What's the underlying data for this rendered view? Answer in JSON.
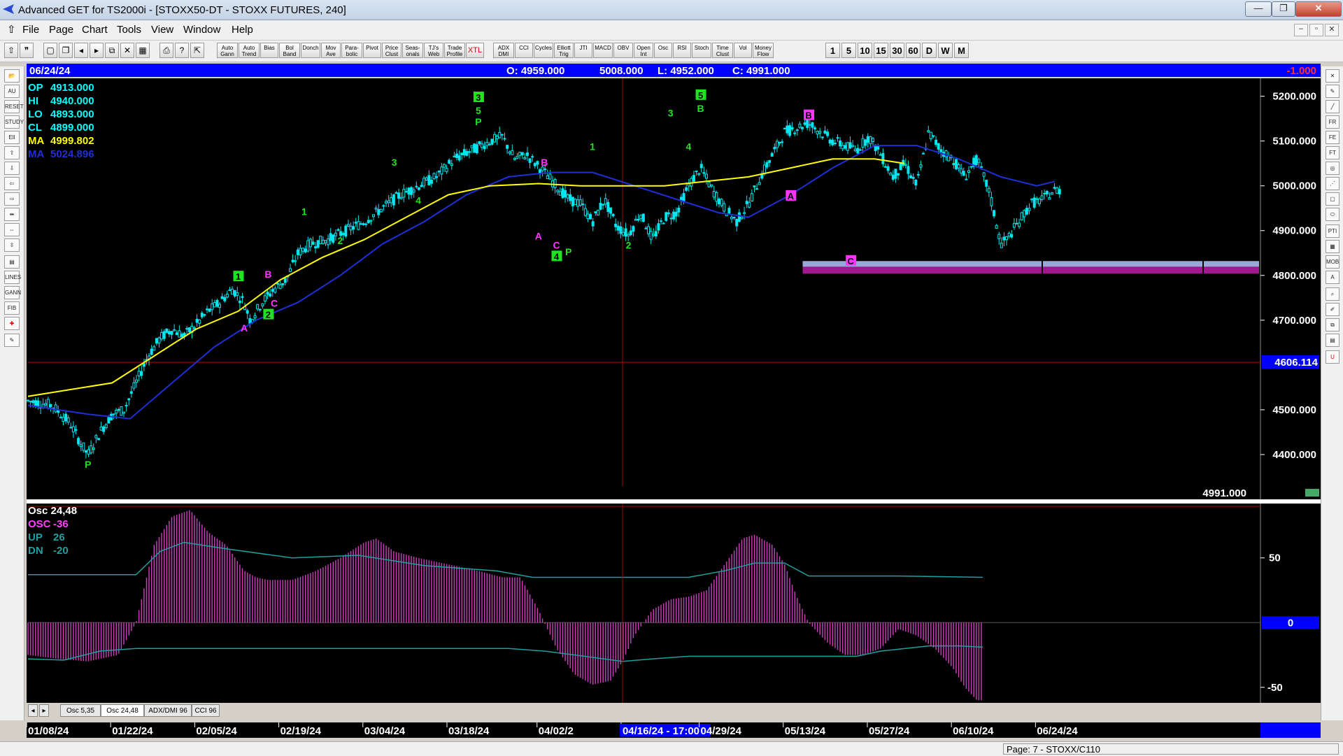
{
  "window": {
    "title": "Advanced GET for TS2000i - [STOXX50-DT - STOXX FUTURES, 240]"
  },
  "menu": [
    "File",
    "Page",
    "Chart",
    "Tools",
    "View",
    "Window",
    "Help"
  ],
  "toolbar": {
    "study_buttons": [
      "Auto Gann",
      "Auto Trend",
      "Bias",
      "Bol Band",
      "Donch",
      "Mov Ave",
      "Para-bolic",
      "Pivot",
      "Price Clust",
      "Seas-onals",
      "TJ's Web",
      "Trade Profile",
      "XTL",
      "ADX DMI",
      "CCI",
      "Cycles",
      "Elliott Trig",
      "JTI",
      "MACD",
      "OBV",
      "Open Int",
      "Osc",
      "RSI",
      "Stoch",
      "Time Clust",
      "Vol",
      "Money Flow"
    ],
    "periods": [
      "1",
      "5",
      "10",
      "15",
      "30",
      "60",
      "D",
      "W",
      "M"
    ]
  },
  "header": {
    "date": "06/24/24",
    "open": "O: 4959.000",
    "high": "5008.000",
    "low": "L: 4952.000",
    "close": "C: 4991.000",
    "change": "-1.000"
  },
  "price_legend": [
    {
      "label": "OP",
      "value": "4913.000",
      "color": "#00ffff"
    },
    {
      "label": "HI",
      "value": "4940.000",
      "color": "#00ffff"
    },
    {
      "label": "LO",
      "value": "4893.000",
      "color": "#00ffff"
    },
    {
      "label": "CL",
      "value": "4899.000",
      "color": "#00ffff"
    },
    {
      "label": "MA",
      "value": "4999.802",
      "color": "#ffff00"
    },
    {
      "label": "MA",
      "value": "5024.896",
      "color": "#1f2fd6"
    }
  ],
  "osc_legend": [
    {
      "label": "Osc 24,48",
      "value": "",
      "color": "#ffffff"
    },
    {
      "label": "OSC",
      "value": "-36",
      "color": "#ff40ff"
    },
    {
      "label": "UP",
      "value": "26",
      "color": "#1fa0a0"
    },
    {
      "label": "DN",
      "value": "-20",
      "color": "#1fa0a0"
    }
  ],
  "tabs": [
    "Osc 5,35",
    "Osc 24,48",
    "ADX/DMI 96",
    "CCI 96"
  ],
  "status": {
    "page": "Page: 7 - STOXX/C110"
  },
  "colors": {
    "background": "#000000",
    "header_bar": "#0000ff",
    "candle": "#00ffff",
    "ma_fast": "#ffff00",
    "ma_slow": "#1f2fd6",
    "osc_bar": "#d040c0",
    "wave_green": "#22e022",
    "wave_magenta": "#ff33ff"
  },
  "chart_data": [
    {
      "type": "candlestick",
      "title": "STOXX50-DT - STOXX FUTURES, 240",
      "ylim": [
        4300,
        5240
      ],
      "y_ticks": [
        "5200.000",
        "5100.000",
        "5000.000",
        "4900.000",
        "4800.000",
        "4700.000",
        "4600.000",
        "4500.000",
        "4400.000"
      ],
      "x_ticks": [
        "01/08/24",
        "01/22/24",
        "02/05/24",
        "02/19/24",
        "03/04/24",
        "03/18/24",
        "04/02/2",
        "04/16/24 - 17:00",
        "04/29/24",
        "05/13/24",
        "05/27/24",
        "06/10/24",
        "06/24/24"
      ],
      "x_tick_days": [
        0,
        14,
        28,
        42,
        56,
        70,
        85,
        99,
        112,
        126,
        140,
        154,
        168
      ],
      "x_range_days": [
        0,
        205
      ],
      "last_day": 164,
      "trend_path": [
        [
          0,
          4520
        ],
        [
          4,
          4510
        ],
        [
          7,
          4470
        ],
        [
          9,
          4420
        ],
        [
          10,
          4400
        ],
        [
          12,
          4450
        ],
        [
          14,
          4490
        ],
        [
          16,
          4500
        ],
        [
          18,
          4560
        ],
        [
          20,
          4620
        ],
        [
          22,
          4660
        ],
        [
          24,
          4680
        ],
        [
          26,
          4665
        ],
        [
          28,
          4690
        ],
        [
          30,
          4720
        ],
        [
          32,
          4740
        ],
        [
          34,
          4770
        ],
        [
          36,
          4740
        ],
        [
          37,
          4700
        ],
        [
          39,
          4740
        ],
        [
          41,
          4770
        ],
        [
          43,
          4790
        ],
        [
          45,
          4850
        ],
        [
          47,
          4870
        ],
        [
          50,
          4880
        ],
        [
          53,
          4900
        ],
        [
          56,
          4920
        ],
        [
          59,
          4950
        ],
        [
          62,
          4980
        ],
        [
          65,
          5000
        ],
        [
          68,
          5020
        ],
        [
          71,
          5060
        ],
        [
          74,
          5080
        ],
        [
          77,
          5100
        ],
        [
          79,
          5110
        ],
        [
          81,
          5060
        ],
        [
          83,
          5070
        ],
        [
          86,
          5030
        ],
        [
          88,
          5000
        ],
        [
          90,
          4970
        ],
        [
          92,
          4960
        ],
        [
          94,
          4920
        ],
        [
          96,
          4970
        ],
        [
          98,
          4910
        ],
        [
          100,
          4890
        ],
        [
          102,
          4940
        ],
        [
          104,
          4880
        ],
        [
          106,
          4930
        ],
        [
          108,
          4940
        ],
        [
          110,
          5000
        ],
        [
          112,
          5040
        ],
        [
          114,
          4990
        ],
        [
          116,
          4950
        ],
        [
          118,
          4920
        ],
        [
          120,
          4960
        ],
        [
          122,
          5020
        ],
        [
          124,
          5070
        ],
        [
          126,
          5120
        ],
        [
          128,
          5130
        ],
        [
          130,
          5140
        ],
        [
          132,
          5120
        ],
        [
          134,
          5100
        ],
        [
          136,
          5090
        ],
        [
          138,
          5080
        ],
        [
          140,
          5110
        ],
        [
          142,
          5070
        ],
        [
          144,
          5020
        ],
        [
          146,
          5050
        ],
        [
          148,
          5000
        ],
        [
          150,
          5120
        ],
        [
          152,
          5080
        ],
        [
          154,
          5060
        ],
        [
          156,
          5020
        ],
        [
          158,
          5060
        ],
        [
          160,
          4990
        ],
        [
          162,
          4870
        ],
        [
          163,
          4880
        ],
        [
          165,
          4920
        ],
        [
          167,
          4960
        ],
        [
          169,
          4970
        ],
        [
          171,
          4990
        ],
        [
          172,
          4991
        ]
      ],
      "ma_fast": [
        [
          0,
          4530
        ],
        [
          14,
          4560
        ],
        [
          21,
          4620
        ],
        [
          28,
          4680
        ],
        [
          35,
          4720
        ],
        [
          42,
          4790
        ],
        [
          49,
          4840
        ],
        [
          56,
          4880
        ],
        [
          63,
          4930
        ],
        [
          70,
          4980
        ],
        [
          77,
          5000
        ],
        [
          85,
          5005
        ],
        [
          92,
          5000
        ],
        [
          99,
          5000
        ],
        [
          106,
          5000
        ],
        [
          113,
          5010
        ],
        [
          120,
          5020
        ],
        [
          127,
          5040
        ],
        [
          134,
          5060
        ],
        [
          141,
          5060
        ],
        [
          146,
          5050
        ]
      ],
      "ma_slow": [
        [
          0,
          4510
        ],
        [
          10,
          4490
        ],
        [
          17,
          4480
        ],
        [
          24,
          4560
        ],
        [
          31,
          4640
        ],
        [
          38,
          4700
        ],
        [
          45,
          4740
        ],
        [
          52,
          4800
        ],
        [
          59,
          4870
        ],
        [
          66,
          4920
        ],
        [
          73,
          4980
        ],
        [
          80,
          5020
        ],
        [
          87,
          5030
        ],
        [
          94,
          5030
        ],
        [
          101,
          5000
        ],
        [
          108,
          4970
        ],
        [
          115,
          4940
        ],
        [
          120,
          4930
        ],
        [
          127,
          4980
        ],
        [
          134,
          5040
        ],
        [
          141,
          5090
        ],
        [
          148,
          5090
        ],
        [
          155,
          5060
        ],
        [
          162,
          5020
        ],
        [
          168,
          5000
        ],
        [
          171,
          5010
        ]
      ],
      "support_band": {
        "from_day": 129,
        "to_day": 205,
        "upper": 4832,
        "lower": 4810
      },
      "horizontal_line": {
        "value": 4606.114,
        "label": "4606.114"
      },
      "crosshair_day": 99,
      "last_price_label": "4991.000",
      "wave_labels": [
        {
          "day": 10,
          "price": 4370,
          "text": "P",
          "color": "green",
          "boxed": false
        },
        {
          "day": 36,
          "price": 4675,
          "text": "A",
          "color": "magenta",
          "boxed": false
        },
        {
          "day": 35,
          "price": 4790,
          "text": "1",
          "color": "green",
          "boxed": true
        },
        {
          "day": 40,
          "price": 4795,
          "text": "B",
          "color": "magenta",
          "boxed": false
        },
        {
          "day": 41,
          "price": 4730,
          "text": "C",
          "color": "magenta",
          "boxed": false
        },
        {
          "day": 40,
          "price": 4705,
          "text": "2",
          "color": "green",
          "boxed": true
        },
        {
          "day": 46,
          "price": 4935,
          "text": "1",
          "color": "green",
          "boxed": false
        },
        {
          "day": 52,
          "price": 4870,
          "text": "2",
          "color": "green",
          "boxed": false
        },
        {
          "day": 61,
          "price": 5045,
          "text": "3",
          "color": "green",
          "boxed": false
        },
        {
          "day": 65,
          "price": 4960,
          "text": "4",
          "color": "green",
          "boxed": false
        },
        {
          "day": 75,
          "price": 5190,
          "text": "3",
          "color": "green",
          "boxed": true
        },
        {
          "day": 75,
          "price": 5160,
          "text": "5",
          "color": "green",
          "boxed": false
        },
        {
          "day": 75,
          "price": 5135,
          "text": "P",
          "color": "green",
          "boxed": false
        },
        {
          "day": 86,
          "price": 5045,
          "text": "B",
          "color": "magenta",
          "boxed": false
        },
        {
          "day": 85,
          "price": 4880,
          "text": "A",
          "color": "magenta",
          "boxed": false
        },
        {
          "day": 88,
          "price": 4860,
          "text": "C",
          "color": "magenta",
          "boxed": false
        },
        {
          "day": 88,
          "price": 4835,
          "text": "4",
          "color": "green",
          "boxed": true
        },
        {
          "day": 90,
          "price": 4845,
          "text": "P",
          "color": "green",
          "boxed": false
        },
        {
          "day": 94,
          "price": 5080,
          "text": "1",
          "color": "green",
          "boxed": false
        },
        {
          "day": 100,
          "price": 4860,
          "text": "2",
          "color": "green",
          "boxed": false
        },
        {
          "day": 107,
          "price": 5155,
          "text": "3",
          "color": "green",
          "boxed": false
        },
        {
          "day": 110,
          "price": 5080,
          "text": "4",
          "color": "green",
          "boxed": false
        },
        {
          "day": 112,
          "price": 5195,
          "text": "5",
          "color": "green",
          "boxed": true
        },
        {
          "day": 112,
          "price": 5165,
          "text": "B",
          "color": "green",
          "boxed": false
        },
        {
          "day": 130,
          "price": 5150,
          "text": "B",
          "color": "magenta",
          "boxed": true
        },
        {
          "day": 127,
          "price": 4970,
          "text": "A",
          "color": "magenta",
          "boxed": true
        },
        {
          "day": 137,
          "price": 4825,
          "text": "C",
          "color": "magenta",
          "boxed": true
        }
      ]
    },
    {
      "type": "bar",
      "title": "Osc 24,48",
      "ylim": [
        -62,
        92
      ],
      "y_ticks": [
        "50",
        "0",
        "-50"
      ],
      "osc_path": [
        [
          0,
          -25
        ],
        [
          5,
          -28
        ],
        [
          10,
          -30
        ],
        [
          15,
          -25
        ],
        [
          18,
          0
        ],
        [
          21,
          60
        ],
        [
          24,
          82
        ],
        [
          27,
          87
        ],
        [
          30,
          70
        ],
        [
          33,
          60
        ],
        [
          36,
          40
        ],
        [
          38,
          35
        ],
        [
          40,
          33
        ],
        [
          44,
          33
        ],
        [
          48,
          40
        ],
        [
          52,
          50
        ],
        [
          56,
          62
        ],
        [
          58,
          65
        ],
        [
          61,
          55
        ],
        [
          65,
          50
        ],
        [
          70,
          45
        ],
        [
          75,
          40
        ],
        [
          79,
          35
        ],
        [
          82,
          35
        ],
        [
          85,
          10
        ],
        [
          88,
          -20
        ],
        [
          91,
          -40
        ],
        [
          94,
          -48
        ],
        [
          97,
          -45
        ],
        [
          99,
          -30
        ],
        [
          101,
          -10
        ],
        [
          104,
          10
        ],
        [
          107,
          18
        ],
        [
          110,
          20
        ],
        [
          113,
          25
        ],
        [
          116,
          45
        ],
        [
          119,
          65
        ],
        [
          121,
          68
        ],
        [
          124,
          60
        ],
        [
          126,
          45
        ],
        [
          128,
          20
        ],
        [
          130,
          0
        ],
        [
          133,
          -15
        ],
        [
          136,
          -25
        ],
        [
          139,
          -25
        ],
        [
          142,
          -20
        ],
        [
          145,
          -5
        ],
        [
          148,
          -10
        ],
        [
          151,
          -20
        ],
        [
          154,
          -35
        ],
        [
          156,
          -50
        ],
        [
          158,
          -60
        ],
        [
          159,
          -60
        ]
      ],
      "up_line": [
        [
          0,
          37
        ],
        [
          14,
          37
        ],
        [
          18,
          37
        ],
        [
          22,
          55
        ],
        [
          26,
          62
        ],
        [
          33,
          57
        ],
        [
          44,
          50
        ],
        [
          55,
          52
        ],
        [
          66,
          44
        ],
        [
          78,
          40
        ],
        [
          84,
          35
        ],
        [
          99,
          35
        ],
        [
          110,
          35
        ],
        [
          116,
          40
        ],
        [
          121,
          46
        ],
        [
          126,
          46
        ],
        [
          130,
          36
        ],
        [
          145,
          36
        ],
        [
          159,
          35
        ]
      ],
      "dn_line": [
        [
          0,
          -28
        ],
        [
          6,
          -29
        ],
        [
          12,
          -22
        ],
        [
          18,
          -20
        ],
        [
          30,
          -20
        ],
        [
          60,
          -20
        ],
        [
          80,
          -20
        ],
        [
          86,
          -22
        ],
        [
          91,
          -25
        ],
        [
          99,
          -30
        ],
        [
          104,
          -28
        ],
        [
          110,
          -26
        ],
        [
          120,
          -26
        ],
        [
          130,
          -26
        ],
        [
          138,
          -26
        ],
        [
          142,
          -22
        ],
        [
          150,
          -18
        ],
        [
          155,
          -18
        ],
        [
          159,
          -19
        ]
      ],
      "last_day": 159,
      "crosshair_day": 99
    }
  ]
}
